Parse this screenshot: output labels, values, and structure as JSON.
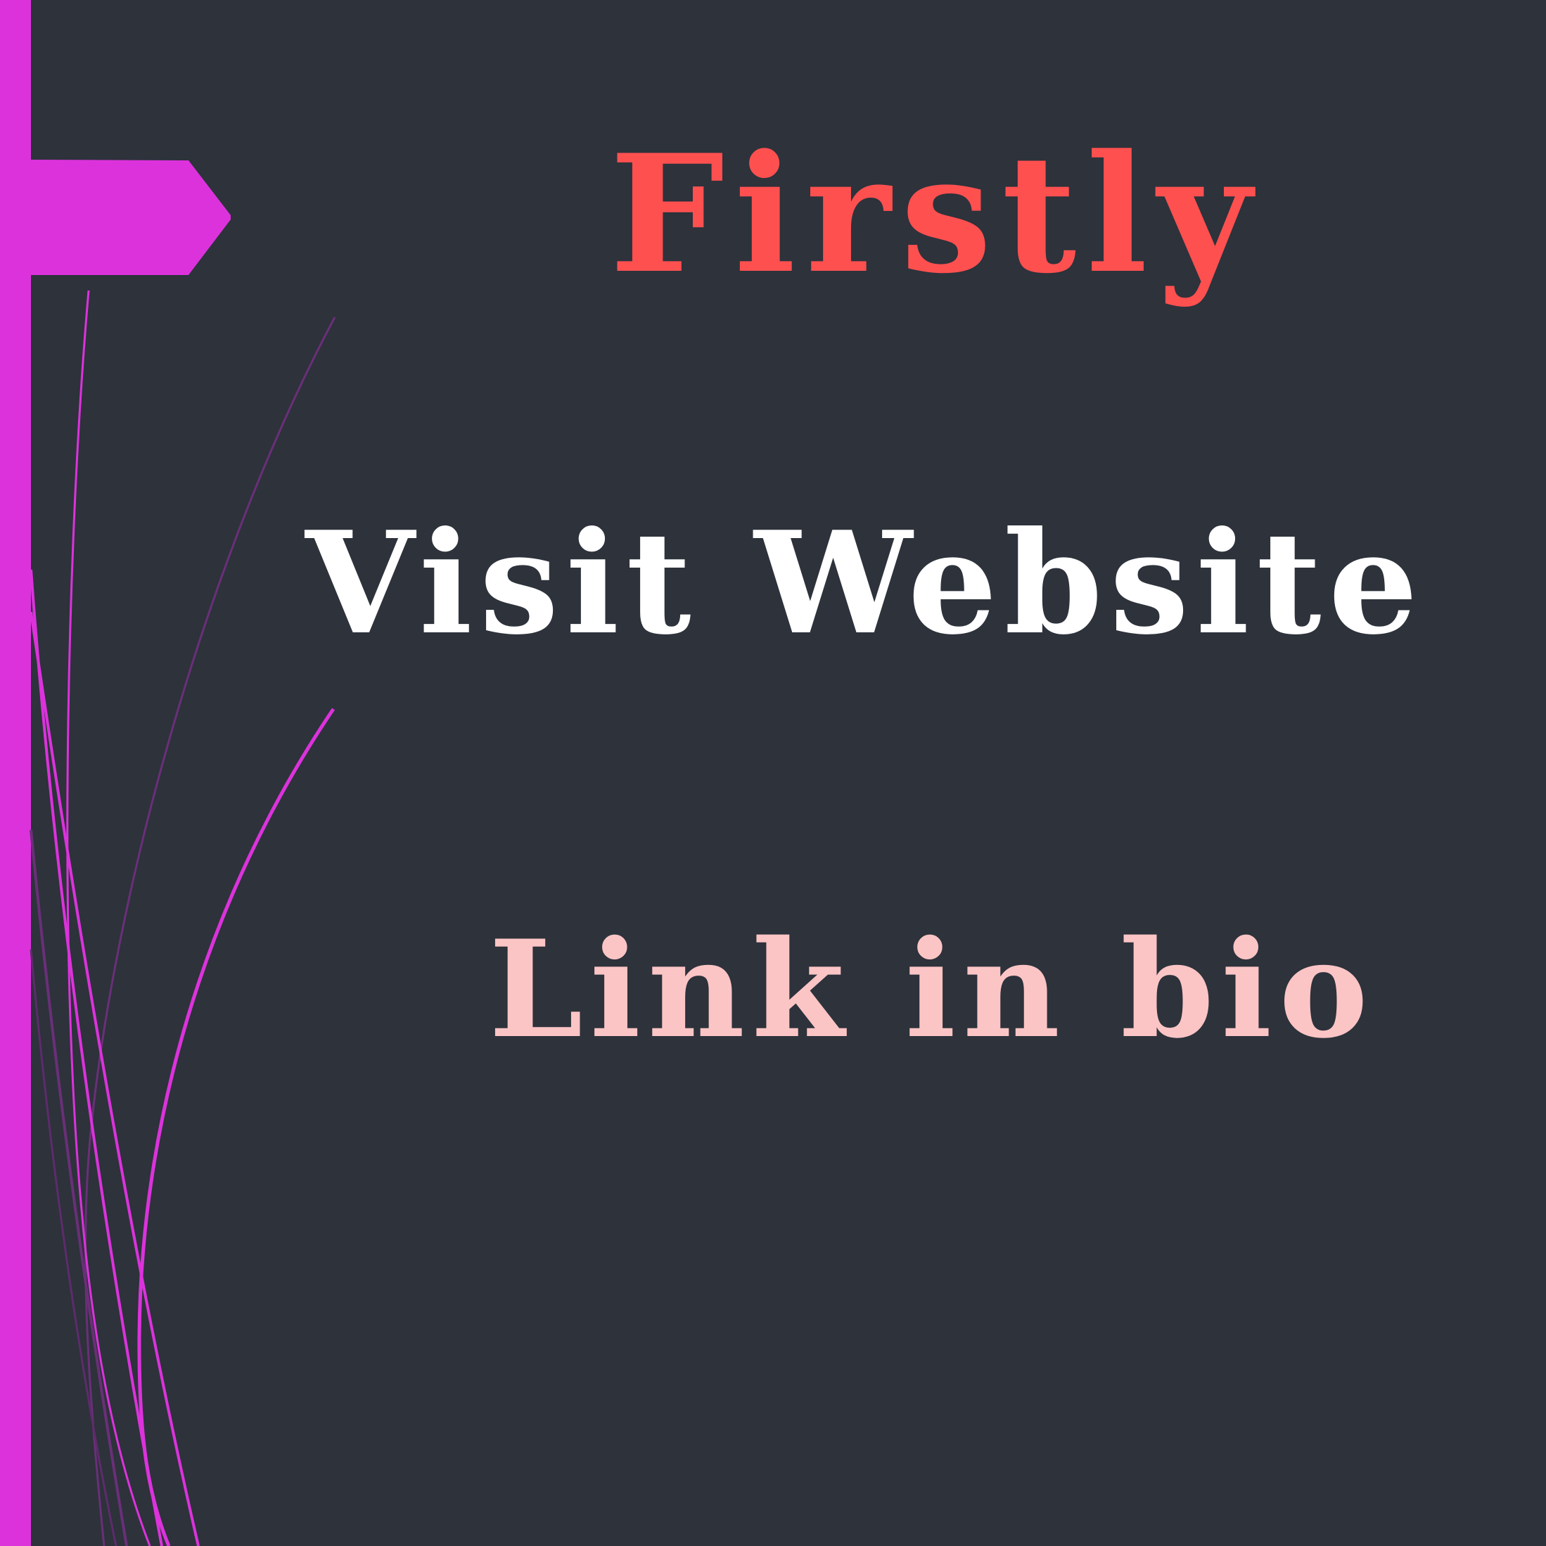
{
  "slide": {
    "title": "Firstly",
    "subtitle": "Visit Website",
    "cta": "Link in bio"
  },
  "colors": {
    "background": "#2d323b",
    "accent": "#dc32dc",
    "title": "#ff5050",
    "subtitle": "#ffffff",
    "cta": "#fcc5c5"
  },
  "icons": {
    "arrow": "arrow-tab-icon"
  }
}
